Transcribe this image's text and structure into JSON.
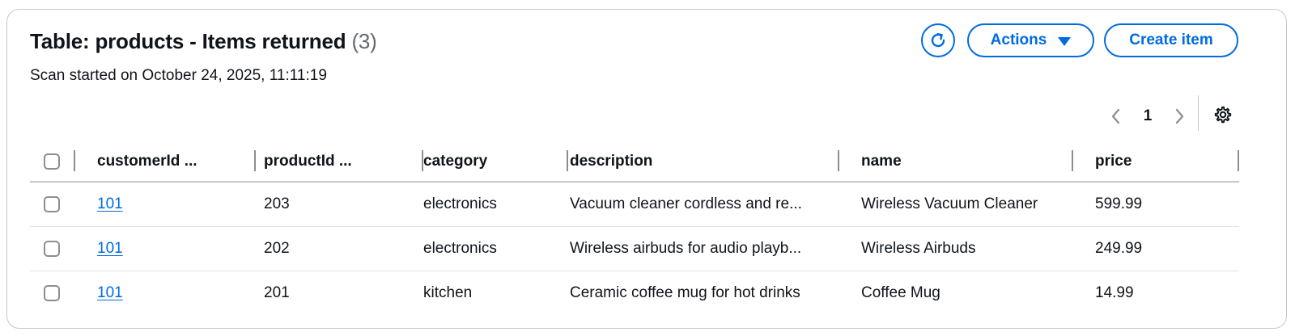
{
  "header": {
    "title": "Table: products - Items returned",
    "count": "(3)",
    "subtitle": "Scan started on October 24, 2025, 11:11:19"
  },
  "toolbar": {
    "refresh_icon": "refresh-icon",
    "actions_label": "Actions",
    "create_label": "Create item"
  },
  "pagination": {
    "current_page": "1"
  },
  "colors": {
    "accent": "#006ce0",
    "border": "#c6c6cd",
    "text": "#0f141a"
  },
  "table": {
    "columns": [
      "customerId ...",
      "productId ...",
      "category",
      "description",
      "name",
      "price"
    ],
    "rows": [
      {
        "customerId": "101",
        "productId": "203",
        "category": "electronics",
        "description": "Vacuum cleaner cordless and re...",
        "name": "Wireless Vacuum Cleaner",
        "price": "599.99"
      },
      {
        "customerId": "101",
        "productId": "202",
        "category": "electronics",
        "description": "Wireless airbuds for audio playb...",
        "name": "Wireless Airbuds",
        "price": "249.99"
      },
      {
        "customerId": "101",
        "productId": "201",
        "category": "kitchen",
        "description": "Ceramic coffee mug for hot drinks",
        "name": "Coffee Mug",
        "price": "14.99"
      }
    ]
  }
}
